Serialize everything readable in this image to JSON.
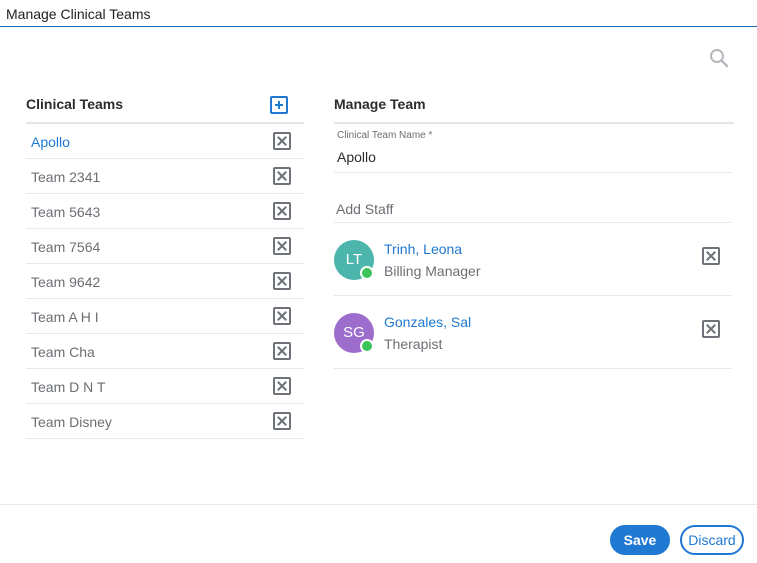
{
  "window": {
    "title": "Manage Clinical Teams"
  },
  "search": {
    "icon": "search-icon"
  },
  "clinical_teams": {
    "header": "Clinical Teams",
    "add_icon": "add-square-icon",
    "items": [
      {
        "label": "Apollo",
        "active": true
      },
      {
        "label": "Team 2341",
        "active": false
      },
      {
        "label": "Team 5643",
        "active": false
      },
      {
        "label": "Team 7564",
        "active": false
      },
      {
        "label": "Team 9642",
        "active": false
      },
      {
        "label": "Team A H I",
        "active": false
      },
      {
        "label": "Team Cha",
        "active": false
      },
      {
        "label": "Team D N T",
        "active": false
      },
      {
        "label": "Team Disney",
        "active": false
      }
    ]
  },
  "manage_team": {
    "header": "Manage Team",
    "team_name_label": "Clinical Team Name *",
    "team_name_value": "Apollo",
    "add_staff_placeholder": "Add Staff",
    "staff": [
      {
        "initials": "LT",
        "name": "Trinh, Leona",
        "role": "Billing Manager",
        "avatar_color": "#4db6ac",
        "online": true
      },
      {
        "initials": "SG",
        "name": "Gonzales, Sal",
        "role": "Therapist",
        "avatar_color": "#9c6dcc",
        "online": true
      }
    ]
  },
  "footer": {
    "save_label": "Save",
    "discard_label": "Discard"
  },
  "colors": {
    "accent": "#1f78d1",
    "online": "#3cc35a",
    "muted_text": "#6b6f74"
  }
}
